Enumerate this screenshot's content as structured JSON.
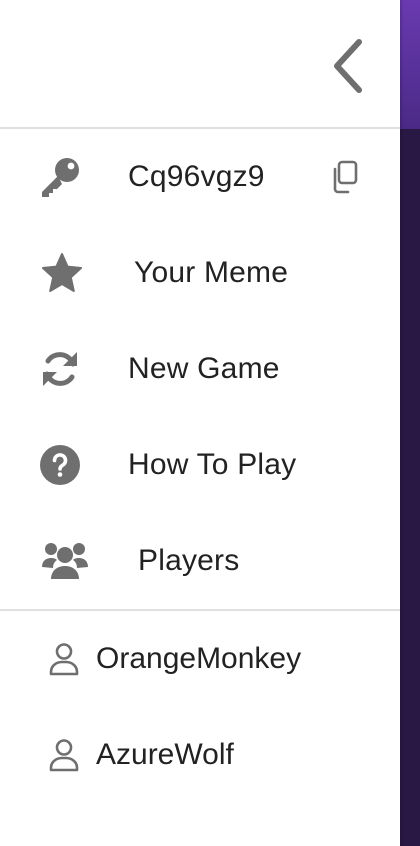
{
  "colors": {
    "icon": "#6f6f6f",
    "text": "#222222",
    "divider": "#e0e0e0",
    "drawer_bg": "#ffffff",
    "app_bg": "#2a1844"
  },
  "header": {
    "close_icon": "chevron-left-icon"
  },
  "menu": {
    "items": [
      {
        "label": "Cq96vgz9",
        "icon": "key-icon",
        "action_icon": "copy-icon"
      },
      {
        "label": "Your Meme",
        "icon": "star-icon"
      },
      {
        "label": "New Game",
        "icon": "refresh-icon"
      },
      {
        "label": "How To Play",
        "icon": "question-circle-icon"
      },
      {
        "label": "Players",
        "icon": "users-icon"
      }
    ]
  },
  "players": [
    {
      "name": "OrangeMonkey",
      "icon": "user-icon"
    },
    {
      "name": "AzureWolf",
      "icon": "user-icon"
    }
  ]
}
